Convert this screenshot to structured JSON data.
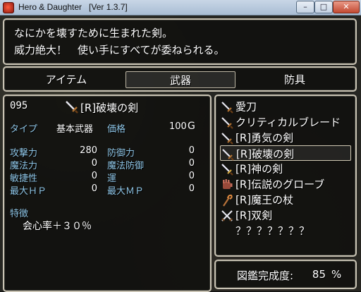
{
  "window": {
    "title": "Hero & Daughter   [Ver 1.3.7]",
    "min_glyph": "–",
    "max_glyph": "□",
    "close_glyph": "✕"
  },
  "description": {
    "line1": "なにかを壊すために生まれた剣。",
    "line2": "威力絶大！　使い手にすべてが委ねられる。"
  },
  "tabs": [
    {
      "label": "アイテム",
      "selected": false
    },
    {
      "label": "武器",
      "selected": true
    },
    {
      "label": "防具",
      "selected": false
    }
  ],
  "detail": {
    "number": "095",
    "name": "[R]破壊の剣",
    "icon": "sword-icon",
    "type_label": "タイプ",
    "type_value": "基本武器",
    "price_label": "価格",
    "price_value": "100",
    "price_unit": "G",
    "stats": [
      {
        "label": "攻撃力",
        "value": "280"
      },
      {
        "label": "魔法力",
        "value": "0"
      },
      {
        "label": "敏捷性",
        "value": "0"
      },
      {
        "label": "最大ＨＰ",
        "value": "0"
      }
    ],
    "stats2": [
      {
        "label": "防御力",
        "value": "0"
      },
      {
        "label": "魔法防御",
        "value": "0"
      },
      {
        "label": "運",
        "value": "0"
      },
      {
        "label": "最大ＭＰ",
        "value": "0"
      }
    ],
    "traits_label": "特徴",
    "traits": [
      "会心率＋３０％"
    ]
  },
  "list": [
    {
      "label": "愛刀",
      "icon": "sword-icon",
      "selected": false
    },
    {
      "label": "クリティカルブレード",
      "icon": "sword-icon",
      "selected": false
    },
    {
      "label": "[R]勇気の剣",
      "icon": "sword-icon",
      "selected": false
    },
    {
      "label": "[R]破壊の剣",
      "icon": "sword-icon",
      "selected": true
    },
    {
      "label": "[R]神の剣",
      "icon": "sword-icon",
      "selected": false
    },
    {
      "label": "[R]伝説のグローブ",
      "icon": "glove-icon",
      "selected": false
    },
    {
      "label": "[R]魔王の杖",
      "icon": "staff-icon",
      "selected": false
    },
    {
      "label": "[R]双剣",
      "icon": "twin-swords-icon",
      "selected": false
    },
    {
      "label": "？？？？？？？",
      "icon": "",
      "selected": false
    }
  ],
  "progress": {
    "label": "図鑑完成度:",
    "value": "85",
    "unit": "%"
  },
  "colors": {
    "stat_label": "#8ec5e6",
    "text": "#ffffff",
    "frame": "#c9c3b4"
  }
}
